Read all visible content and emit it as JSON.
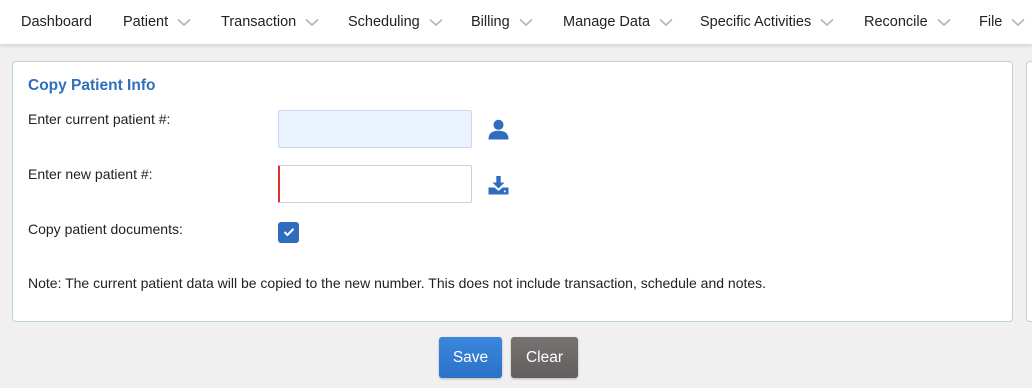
{
  "nav": {
    "items": [
      {
        "label": "Dashboard",
        "has_menu": false
      },
      {
        "label": "Patient",
        "has_menu": true
      },
      {
        "label": "Transaction",
        "has_menu": true
      },
      {
        "label": "Scheduling",
        "has_menu": true
      },
      {
        "label": "Billing",
        "has_menu": true
      },
      {
        "label": "Manage Data",
        "has_menu": true
      },
      {
        "label": "Specific Activities",
        "has_menu": true
      },
      {
        "label": "Reconcile",
        "has_menu": true
      },
      {
        "label": "File",
        "has_menu": true
      }
    ]
  },
  "form": {
    "title": "Copy Patient Info",
    "current_label": "Enter current patient #:",
    "current_value": "",
    "new_label": "Enter new patient #:",
    "new_value": "",
    "copy_docs_label": "Copy patient documents:",
    "copy_docs_checked": true,
    "note": "Note: The current patient data will be copied to the new number. This does not include transaction, schedule and notes."
  },
  "actions": {
    "save_label": "Save",
    "clear_label": "Clear"
  },
  "icons": {
    "current_lookup": "user-icon",
    "new_lookup": "download-icon",
    "nav_chevron": "chevron-down-icon",
    "checkbox_mark": "checkmark-icon"
  },
  "colors": {
    "accent": "#2e6fbe",
    "save_button": "#2a72c8",
    "clear_button": "#656261",
    "required_marker": "#d9342b",
    "card_border": "#b9d8bb"
  }
}
